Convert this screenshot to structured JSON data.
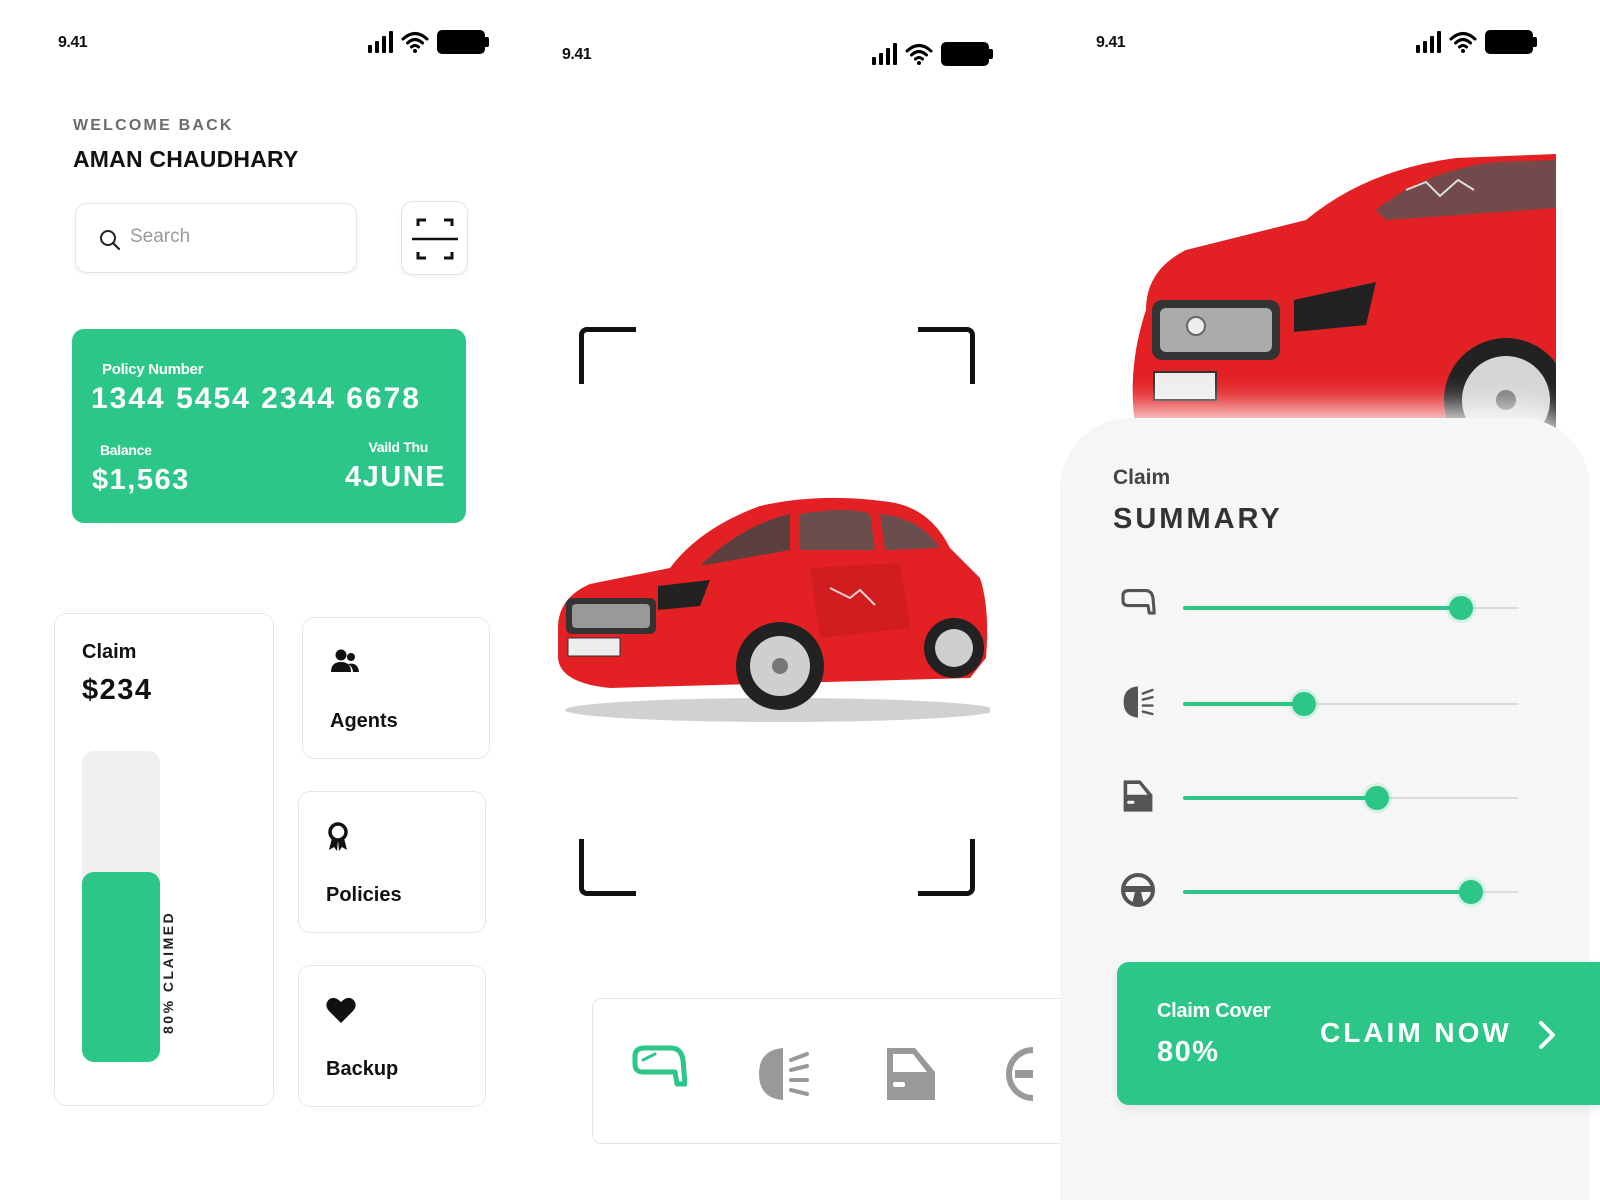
{
  "colors": {
    "accent": "#2bc688",
    "car_red": "#e32124"
  },
  "screens": [
    {
      "status": {
        "time": "9.41"
      }
    },
    {
      "status": {
        "time": "9.41"
      }
    },
    {
      "status": {
        "time": "9.41"
      }
    }
  ],
  "home": {
    "welcome": "WELCOME BACK",
    "user_name": "AMAN CHAUDHARY",
    "search_placeholder": "Search",
    "policy_card": {
      "policy_label": "Policy Number",
      "policy_number": "1344 5454 2344 6678",
      "balance_label": "Balance",
      "balance_value": "$1,563",
      "valid_label": "Vaild Thu",
      "valid_value": "4JUNE"
    },
    "claim": {
      "label": "Claim",
      "amount": "$234",
      "claimed_text": "80% CLAIMED",
      "claimed_fraction": 0.61
    },
    "tiles": [
      {
        "label": "Agents",
        "icon": "agents-icon"
      },
      {
        "label": "Policies",
        "icon": "ribbon-icon"
      },
      {
        "label": "Backup",
        "icon": "heart-icon"
      }
    ]
  },
  "scan": {
    "parts": [
      {
        "icon": "side-mirror-icon",
        "active": true
      },
      {
        "icon": "headlight-icon",
        "active": false
      },
      {
        "icon": "car-door-icon",
        "active": false
      },
      {
        "icon": "steering-wheel-icon",
        "active": false
      }
    ]
  },
  "summary": {
    "title_small": "Claim",
    "title_large": "SUMMARY",
    "sliders": [
      {
        "icon": "side-mirror-icon",
        "value": 0.83
      },
      {
        "icon": "headlight-icon",
        "value": 0.36
      },
      {
        "icon": "car-door-icon",
        "value": 0.58
      },
      {
        "icon": "steering-wheel-icon",
        "value": 0.86
      }
    ],
    "claim_cover_label": "Claim Cover",
    "claim_cover_value": "80%",
    "claim_now_label": "CLAIM NOW"
  }
}
